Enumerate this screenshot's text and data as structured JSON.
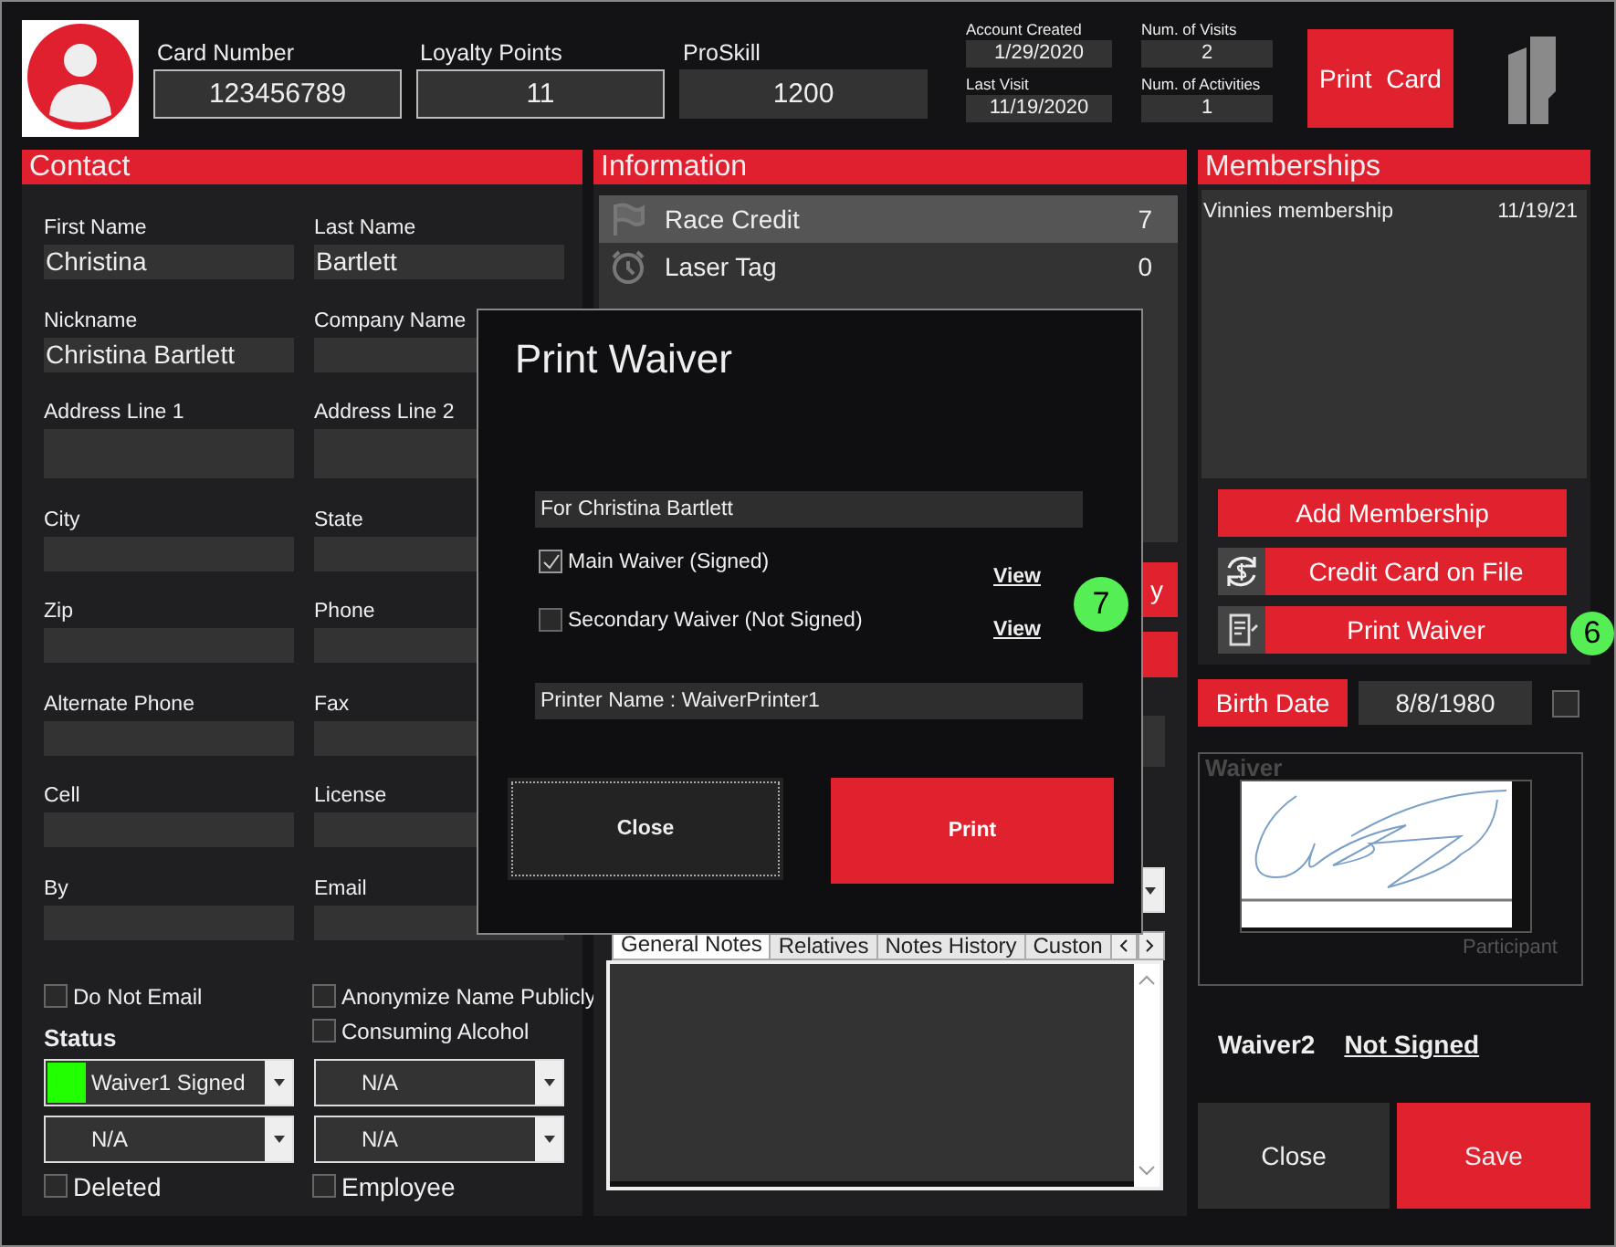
{
  "header": {
    "fields": [
      {
        "label": "Card Number",
        "value": "123456789",
        "kind": "outlined"
      },
      {
        "label": "Loyalty Points",
        "value": "11",
        "kind": "outlined"
      },
      {
        "label": "ProSkill",
        "value": "1200",
        "kind": "filled"
      }
    ],
    "stats": [
      {
        "label": "Account Created",
        "value": "1/29/2020"
      },
      {
        "label": "Num. of Visits",
        "value": "2"
      },
      {
        "label": "Last Visit",
        "value": "11/19/2020"
      },
      {
        "label": "Num. of Activities",
        "value": "1"
      }
    ],
    "print_card_button": "Print  Card"
  },
  "contact": {
    "title": "Contact",
    "fields": [
      {
        "label": "First Name",
        "value": "Christina"
      },
      {
        "label": "Last Name",
        "value": "Bartlett"
      },
      {
        "label": "Nickname",
        "value": "Christina Bartlett"
      },
      {
        "label": "Company Name"
      },
      {
        "label": "Address Line 1",
        "kind": "tall"
      },
      {
        "label": "Address Line 2",
        "kind": "tall"
      },
      {
        "label": "City"
      },
      {
        "label": "State"
      },
      {
        "label": "Zip"
      },
      {
        "label": "Phone"
      },
      {
        "label": "Alternate Phone"
      },
      {
        "label": "Fax"
      },
      {
        "label": "Cell"
      },
      {
        "label": "License"
      },
      {
        "label": "By"
      },
      {
        "label": "Email"
      }
    ],
    "options_left": [
      {
        "label": "Do Not Email",
        "checked": false
      }
    ],
    "options_right": [
      {
        "label": "Anonymize Name Publicly",
        "checked": false
      },
      {
        "label": "Consuming Alcohol",
        "checked": false
      }
    ],
    "status_label": "Status",
    "dropdowns": [
      {
        "value": "Waiver1 Signed",
        "color": "#22ff00"
      },
      {
        "value": "N/A"
      },
      {
        "value": "N/A"
      },
      {
        "value": "N/A"
      }
    ],
    "bottom_options": [
      {
        "label": "Deleted",
        "checked": false
      },
      {
        "label": "Employee",
        "checked": false
      }
    ]
  },
  "information": {
    "title": "Information",
    "items": [
      {
        "label": "Race Credit",
        "count": "7",
        "kind": "flag",
        "selected": true
      },
      {
        "label": "Laser Tag",
        "count": "0",
        "kind": "clock",
        "selected": false
      }
    ],
    "action_button": "y",
    "tabs": [
      {
        "label": "General Notes",
        "selected": true
      },
      {
        "label": "Relatives",
        "selected": false
      },
      {
        "label": "Notes History",
        "selected": false
      },
      {
        "label": "Custon",
        "selected": false
      }
    ]
  },
  "memberships": {
    "title": "Memberships",
    "items": [
      {
        "name": "Vinnies membership",
        "date": "11/19/21"
      }
    ],
    "buttons": [
      {
        "label": "Add Membership",
        "kind": "plain"
      },
      {
        "label": "Credit Card on File",
        "kind": "card"
      },
      {
        "label": "Print Waiver",
        "kind": "waiver"
      }
    ],
    "birth_date": {
      "label": "Birth Date",
      "value": "8/8/1980",
      "checked": false
    },
    "waiver": {
      "title": "Waiver",
      "caption": "Participant"
    },
    "waiver2": {
      "label": "Waiver2",
      "status": "Not Signed"
    },
    "close_button": "Close",
    "save_button": "Save"
  },
  "modal": {
    "title": "Print Waiver",
    "for_field": "For Christina Bartlett",
    "waivers": [
      {
        "label": "Main Waiver (Signed)",
        "checked": true,
        "link": "View"
      },
      {
        "label": "Secondary Waiver (Not Signed)",
        "checked": false,
        "link": "View"
      }
    ],
    "printer_field": "Printer Name : WaiverPrinter1",
    "close_button": "Close",
    "print_button": "Print"
  },
  "annotations": [
    {
      "number": "7"
    },
    {
      "number": "6"
    }
  ]
}
